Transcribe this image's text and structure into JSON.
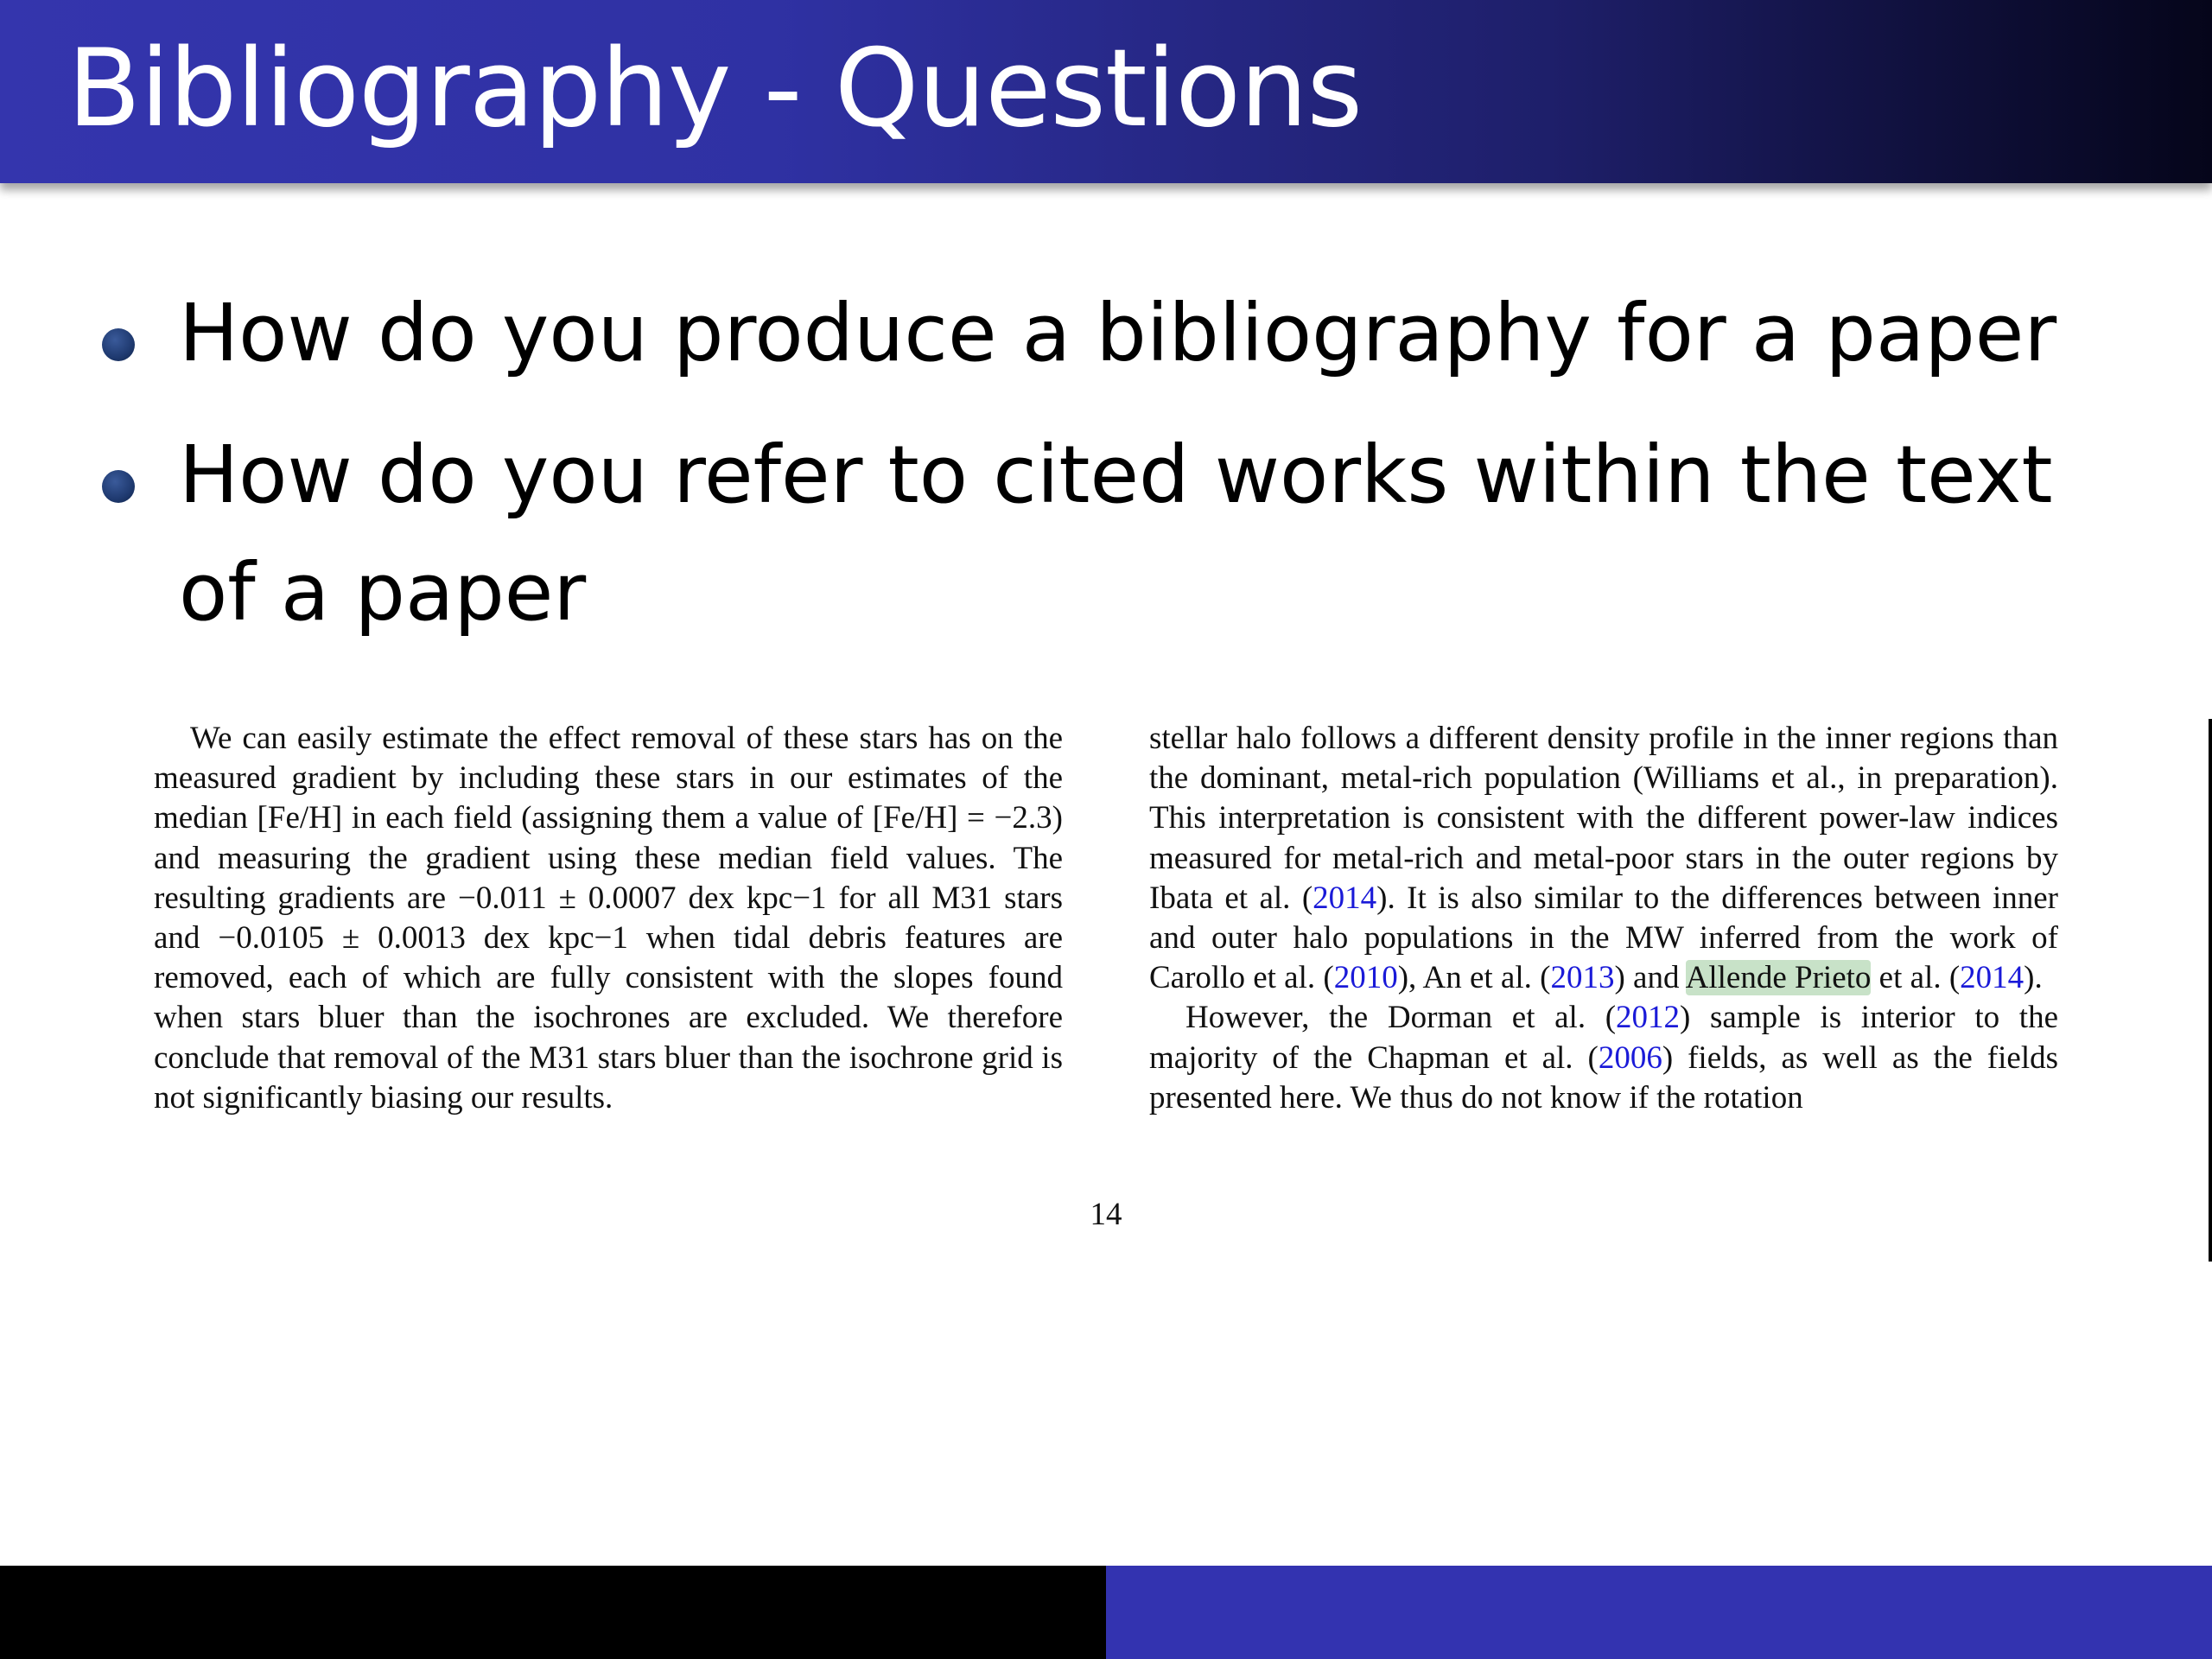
{
  "slide": {
    "title": "Bibliography - Questions",
    "bullets": [
      "How do you produce a bibliography for a paper",
      "How do you refer to cited works within the text of a paper"
    ]
  },
  "excerpt": {
    "left_column": "We can easily estimate the effect removal of these stars has on the measured gradient by including these stars in our estimates of the median [Fe/H] in each field (assigning them a value of [Fe/H] = −2.3) and measuring the gradient using these median field values. The resulting gradients are −0.011 ± 0.0007 dex kpc−1 for all M31 stars and −0.0105 ± 0.0013 dex kpc−1 when tidal debris features are removed, each of which are fully consistent with the slopes found when stars bluer than the isochrones are excluded. We therefore conclude that removal of the M31 stars bluer than the isochrone grid is not significantly biasing our results.",
    "right_column": {
      "p1_a": "stellar halo follows a different density profile in the inner regions than the dominant, metal-rich population (Williams et al., in preparation). This interpretation is consistent with the different power-law indices measured for metal-rich and metal-poor stars in the outer regions by Ibata et al. (",
      "cite_1": "2014",
      "p1_b": "). It is also similar to the differences between inner and outer halo populations in the MW inferred from the work of Carollo et al. (",
      "cite_2": "2010",
      "p1_c": "), An et al. (",
      "cite_3": "2013",
      "p1_d": ") and ",
      "highlight": "Allende Prieto",
      "p1_e": " et al. (",
      "cite_4": "2014",
      "p1_f": ").",
      "p2_a": "However, the Dorman et al. (",
      "cite_5": "2012",
      "p2_b": ") sample is interior to the majority of the Chapman et al. (",
      "cite_6": "2006",
      "p2_c": ") fields, as well as the fields presented here. We thus do not know if the rotation"
    },
    "page_number": "14"
  },
  "colors": {
    "title_bar_start": "#3435ad",
    "title_bar_end": "#05051a",
    "citation_link": "#1a1ad8",
    "highlight": "#c8e2c8",
    "footer_left": "#000000",
    "footer_right": "#3333b0"
  }
}
